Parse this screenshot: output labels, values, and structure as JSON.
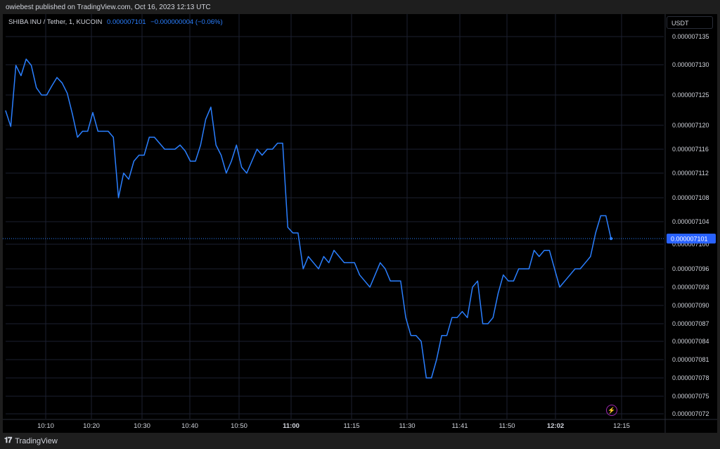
{
  "header": {
    "published": "owiebest published on TradingView.com, Oct 16, 2023 12:13 UTC"
  },
  "legend": {
    "symbol": "SHIBA INU / Tether, 1, KUCOIN",
    "value": "0.000007101",
    "change": "−0.000000004 (−0.06%)"
  },
  "axis": {
    "currency": "USDT"
  },
  "footer": {
    "brand": "TradingView"
  },
  "colors": {
    "line": "#2a7fff",
    "background": "#000000",
    "grid": "#1c2030",
    "text": "#d1d4dc",
    "last_price_bg": "#2962ff"
  },
  "icons": {
    "brand_logo": "tradingview-logo-icon",
    "bolt": "lightning-icon"
  },
  "chart_data": {
    "type": "line",
    "title": "SHIBA INU / Tether, 1, KUCOIN",
    "ylabel": "USDT",
    "grid": true,
    "y_ticks": [
      "0.000007072",
      "0.000007075",
      "0.000007078",
      "0.000007081",
      "0.000007084",
      "0.000007087",
      "0.000007090",
      "0.000007093",
      "0.000007096",
      "0.000007100",
      "0.000007104",
      "0.000007108",
      "0.000007112",
      "0.000007116",
      "0.000007120",
      "0.000007125",
      "0.000007130",
      "0.000007135"
    ],
    "x_ticks": [
      {
        "label": "10:10",
        "bold": false
      },
      {
        "label": "10:20",
        "bold": false
      },
      {
        "label": "10:30",
        "bold": false
      },
      {
        "label": "10:40",
        "bold": false
      },
      {
        "label": "10:50",
        "bold": false
      },
      {
        "label": "11:00",
        "bold": true
      },
      {
        "label": "11:15",
        "bold": false
      },
      {
        "label": "11:30",
        "bold": false
      },
      {
        "label": "11:41",
        "bold": false
      },
      {
        "label": "11:50",
        "bold": false
      },
      {
        "label": "12:02",
        "bold": true
      },
      {
        "label": "12:15",
        "bold": false
      }
    ],
    "last_price_label": "0.000007101",
    "last_price": 7.101e-06,
    "series": [
      {
        "values": [
          7.1224e-06,
          7.1198e-06,
          7.1299e-06,
          7.1282e-06,
          7.131e-06,
          7.1299e-06,
          7.1262e-06,
          7.125e-06,
          7.125e-06,
          7.1265e-06,
          7.1279e-06,
          7.127e-06,
          7.1253e-06,
          7.1219e-06,
          7.118e-06,
          7.119e-06,
          7.119e-06,
          7.1221e-06,
          7.119e-06,
          7.119e-06,
          7.119e-06,
          7.118e-06,
          7.108e-06,
          7.112e-06,
          7.111e-06,
          7.114e-06,
          7.115e-06,
          7.115e-06,
          7.118e-06,
          7.118e-06,
          7.117e-06,
          7.116e-06,
          7.116e-06,
          7.116e-06,
          7.1167e-06,
          7.1157e-06,
          7.114e-06,
          7.114e-06,
          7.1167e-06,
          7.121e-06,
          7.123e-06,
          7.1167e-06,
          7.115e-06,
          7.112e-06,
          7.114e-06,
          7.1167e-06,
          7.113e-06,
          7.112e-06,
          7.114e-06,
          7.116e-06,
          7.115e-06,
          7.116e-06,
          7.116e-06,
          7.117e-06,
          7.117e-06,
          7.103e-06,
          7.102e-06,
          7.102e-06,
          7.096e-06,
          7.098e-06,
          7.097e-06,
          7.096e-06,
          7.098e-06,
          7.097e-06,
          7.099e-06,
          7.098e-06,
          7.097e-06,
          7.097e-06,
          7.097e-06,
          7.095e-06,
          7.094e-06,
          7.093e-06,
          7.095e-06,
          7.097e-06,
          7.096e-06,
          7.094e-06,
          7.094e-06,
          7.094e-06,
          7.088e-06,
          7.085e-06,
          7.085e-06,
          7.084e-06,
          7.078e-06,
          7.078e-06,
          7.081e-06,
          7.085e-06,
          7.085e-06,
          7.088e-06,
          7.088e-06,
          7.089e-06,
          7.088e-06,
          7.093e-06,
          7.094e-06,
          7.087e-06,
          7.087e-06,
          7.088e-06,
          7.092e-06,
          7.095e-06,
          7.094e-06,
          7.094e-06,
          7.096e-06,
          7.096e-06,
          7.096e-06,
          7.099e-06,
          7.098e-06,
          7.099e-06,
          7.099e-06,
          7.096e-06,
          7.093e-06,
          7.094e-06,
          7.095e-06,
          7.096e-06,
          7.096e-06,
          7.097e-06,
          7.098e-06,
          7.102e-06,
          7.105e-06,
          7.105e-06,
          7.101e-06
        ]
      }
    ]
  }
}
